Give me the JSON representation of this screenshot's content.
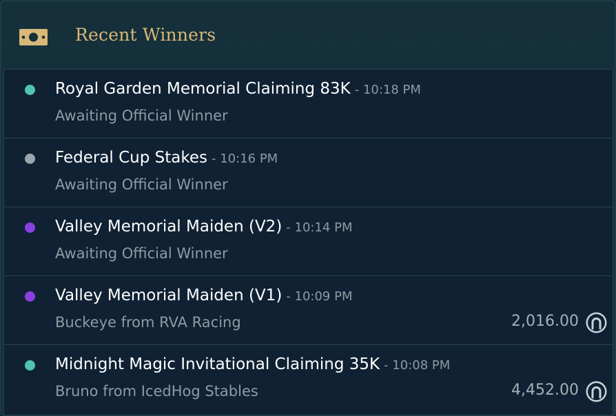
{
  "header": {
    "title": "Recent Winners",
    "icon": "money-icon"
  },
  "colors": {
    "title": "#d9b878",
    "teal": "#52c3b3",
    "gray": "#9aa5ad",
    "purple": "#8a3fe0"
  },
  "winners": [
    {
      "race": "Royal Garden Memorial Claiming 83K",
      "time": "- 10:18 PM",
      "status": "Awaiting Official Winner",
      "dot_color": "#52c3b3",
      "amount": ""
    },
    {
      "race": "Federal Cup Stakes",
      "time": "- 10:16 PM",
      "status": "Awaiting Official Winner",
      "dot_color": "#9aa5ad",
      "amount": ""
    },
    {
      "race": "Valley Memorial Maiden (V2)",
      "time": "- 10:14 PM",
      "status": "Awaiting Official Winner",
      "dot_color": "#8a3fe0",
      "amount": ""
    },
    {
      "race": "Valley Memorial Maiden (V1)",
      "time": "- 10:09 PM",
      "status": "Buckeye from RVA Racing",
      "dot_color": "#8a3fe0",
      "amount": "2,016.00"
    },
    {
      "race": "Midnight Magic Invitational Claiming 35K",
      "time": "- 10:08 PM",
      "status": "Bruno from IcedHog Stables",
      "dot_color": "#52c3b3",
      "amount": "4,452.00"
    }
  ]
}
